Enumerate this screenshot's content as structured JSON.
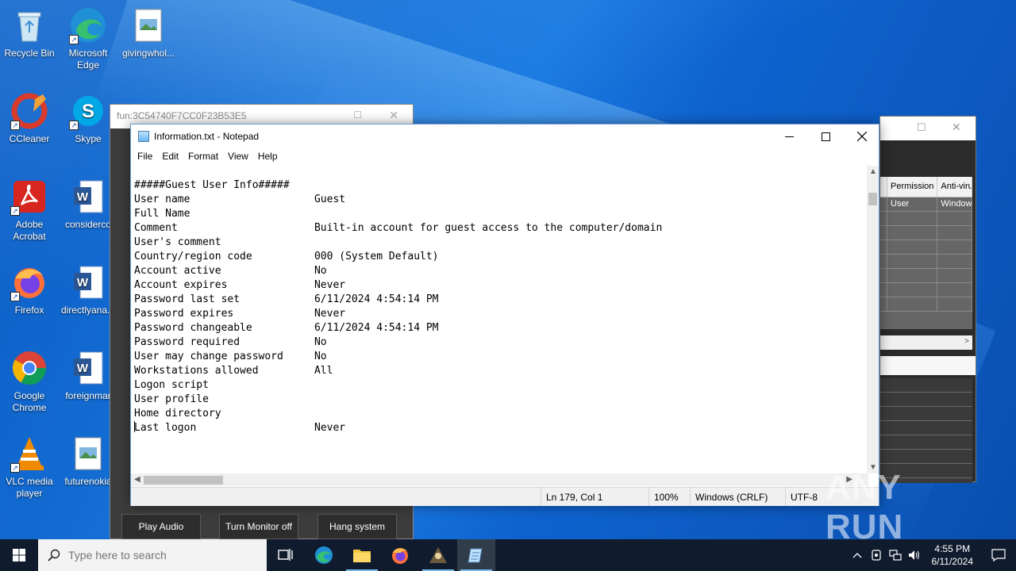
{
  "desktop": {
    "icons": [
      {
        "label": "Recycle Bin"
      },
      {
        "label": "Microsoft Edge"
      },
      {
        "label": "givingwhol..."
      },
      {
        "label": "CCleaner"
      },
      {
        "label": "Skype"
      },
      {
        "label": "Adobe Acrobat"
      },
      {
        "label": "considerco"
      },
      {
        "label": "Firefox"
      },
      {
        "label": "directlyana..."
      },
      {
        "label": "Google Chrome"
      },
      {
        "label": "foreignmar"
      },
      {
        "label": "VLC media player"
      },
      {
        "label": "futurenokia"
      }
    ]
  },
  "fun_window": {
    "title": "fun:3C54740F7CC0F23B53E5",
    "buttons": {
      "play_audio": "Play Audio",
      "turn_monitor_off": "Turn Monitor off",
      "hang_system": "Hang system"
    }
  },
  "bg_window": {
    "columns": [
      "Permission",
      "Anti-viru"
    ],
    "rows": [
      [
        "User",
        "Window"
      ]
    ]
  },
  "notepad": {
    "title": "Information.txt - Notepad",
    "menu": [
      "File",
      "Edit",
      "Format",
      "View",
      "Help"
    ],
    "lines": [
      "#####Guest User Info#####",
      "User name                    Guest",
      "Full Name",
      "Comment                      Built-in account for guest access to the computer/domain",
      "User's comment",
      "Country/region code          000 (System Default)",
      "Account active               No",
      "Account expires              Never",
      "",
      "Password last set            6/11/2024 4:54:14 PM",
      "Password expires             Never",
      "Password changeable          6/11/2024 4:54:14 PM",
      "Password required            No",
      "User may change password     No",
      "",
      "Workstations allowed         All",
      "Logon script",
      "User profile",
      "Home directory",
      "Last logon                   Never"
    ],
    "status": {
      "position": "Ln 179, Col 1",
      "zoom": "100%",
      "line_ending": "Windows (CRLF)",
      "encoding": "UTF-8"
    }
  },
  "watermark": "ANY RUN",
  "taskbar": {
    "search_placeholder": "Type here to search",
    "apps": [
      "task-view",
      "edge",
      "file-explorer",
      "firefox",
      "unknown-app",
      "notepad"
    ],
    "clock": {
      "time": "4:55 PM",
      "date": "6/11/2024"
    }
  },
  "colors": {
    "wallpaper": "#0f63cf",
    "taskbar": "#101c2e",
    "accent": "#76b9ed"
  }
}
